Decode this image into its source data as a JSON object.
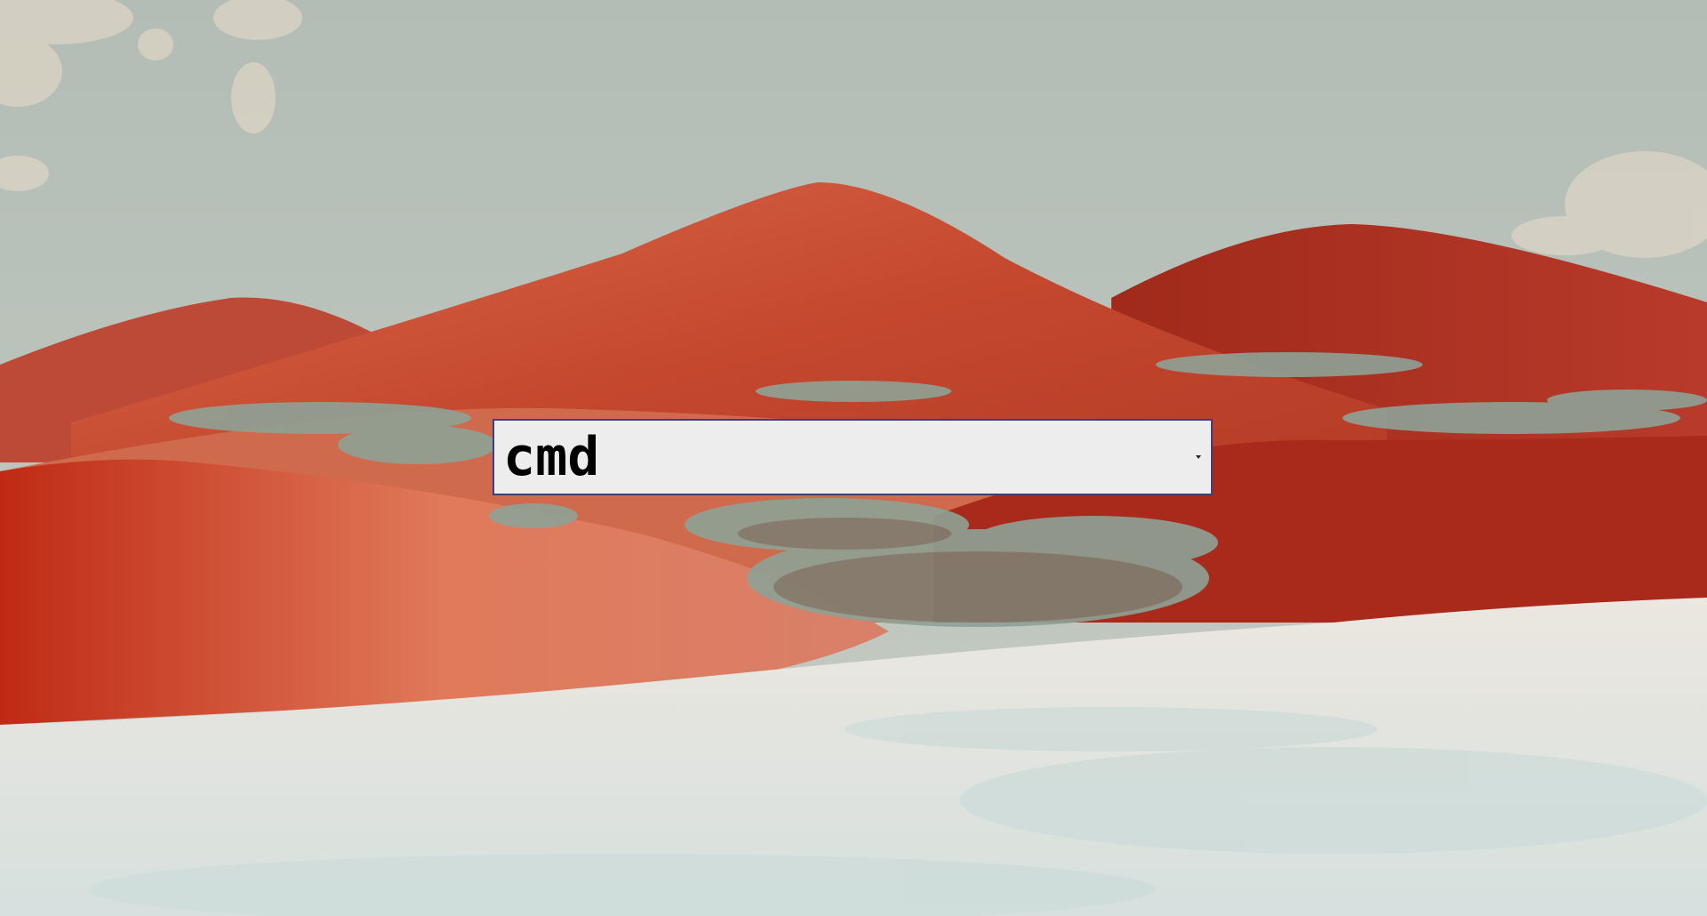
{
  "desktop": {
    "wallpaper_icon": "desert-dunes-wallpaper",
    "colors": {
      "sky": "#b9c2b9",
      "dune_red": "#c4452c",
      "dune_dark": "#8f1d14",
      "sand_white": "#e4e2dc",
      "brush": "#8fa39a"
    }
  },
  "run_dialog": {
    "value": "cmd",
    "dropdown_icon": "chevron-down-icon",
    "colors": {
      "background": "#ededed",
      "border": "#3c3f7a",
      "text": "#000000"
    }
  }
}
